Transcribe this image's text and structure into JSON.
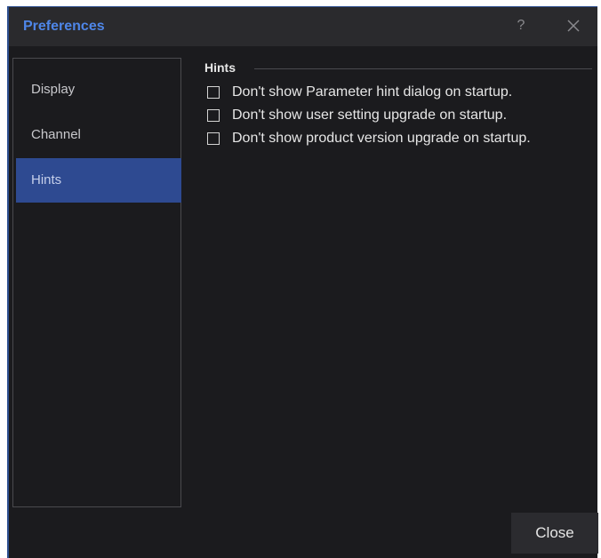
{
  "window": {
    "title": "Preferences",
    "help_label": "?"
  },
  "sidebar": {
    "items": [
      {
        "label": "Display",
        "active": false
      },
      {
        "label": "Channel",
        "active": false
      },
      {
        "label": "Hints",
        "active": true
      }
    ]
  },
  "hints": {
    "group_title": "Hints",
    "options": [
      {
        "label": "Don't show Parameter hint dialog on startup.",
        "checked": false
      },
      {
        "label": "Don't show user setting upgrade on startup.",
        "checked": false
      },
      {
        "label": "Don't show product version upgrade on startup.",
        "checked": false
      }
    ]
  },
  "footer": {
    "close_label": "Close"
  },
  "colors": {
    "accent": "#4e86e8",
    "selection": "#2e4a91",
    "background": "#1b1b1e"
  }
}
